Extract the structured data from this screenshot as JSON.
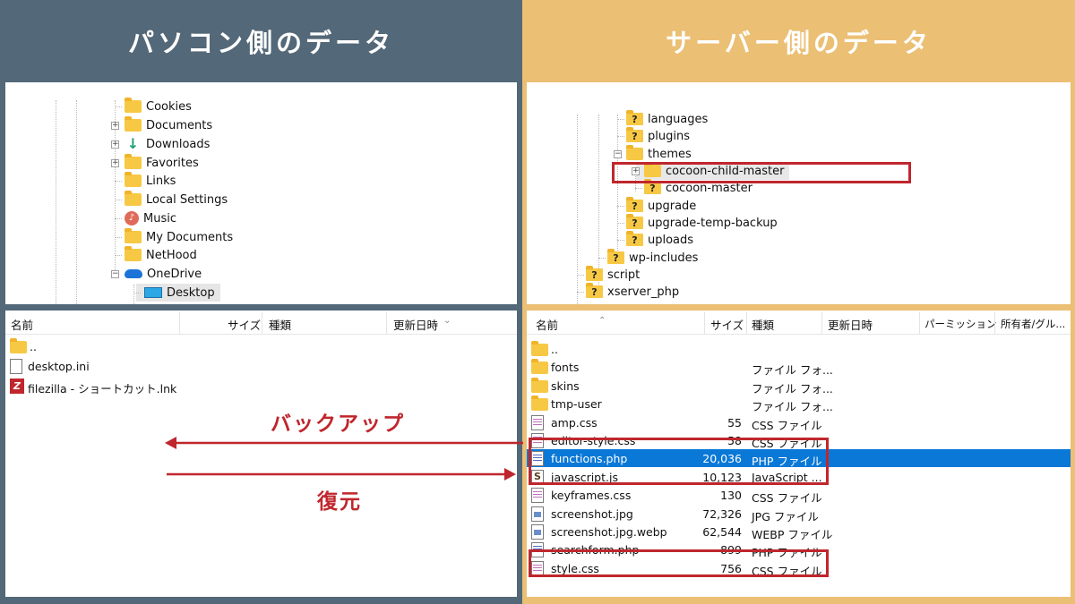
{
  "left": {
    "title": "パソコン側のデータ",
    "tree": [
      {
        "label": "Cookies",
        "icon": "folder-icon",
        "expander": false
      },
      {
        "label": "Documents",
        "icon": "folder-icon",
        "expander": true
      },
      {
        "label": "Downloads",
        "icon": "download-icon",
        "expander": true
      },
      {
        "label": "Favorites",
        "icon": "folder-icon",
        "expander": true
      },
      {
        "label": "Links",
        "icon": "folder-icon",
        "expander": false
      },
      {
        "label": "Local Settings",
        "icon": "folder-icon",
        "expander": false
      },
      {
        "label": "Music",
        "icon": "music-icon",
        "expander": false
      },
      {
        "label": "My Documents",
        "icon": "folder-icon",
        "expander": false
      },
      {
        "label": "NetHood",
        "icon": "folder-icon",
        "expander": false
      },
      {
        "label": "OneDrive",
        "icon": "cloud-icon",
        "expander": true,
        "expanded": true
      },
      {
        "label": "Desktop",
        "icon": "desktop-icon",
        "expander": false,
        "selected": true
      }
    ],
    "headers": {
      "name": "名前",
      "size": "サイズ",
      "type": "種類",
      "modified": "更新日時"
    },
    "files": [
      {
        "name": "..",
        "icon": "folder-icon"
      },
      {
        "name": "desktop.ini",
        "icon": "ini-file-icon"
      },
      {
        "name": "filezilla - ショートカット.lnk",
        "icon": "filezilla-icon"
      }
    ]
  },
  "right": {
    "title": "サーバー側のデータ",
    "tree": [
      {
        "label": "languages",
        "icon": "unknown-folder-icon"
      },
      {
        "label": "plugins",
        "icon": "unknown-folder-icon"
      },
      {
        "label": "themes",
        "icon": "folder-icon",
        "expander": true,
        "expanded": true
      },
      {
        "label": "cocoon-child-master",
        "icon": "folder-icon",
        "expander": true,
        "highlighted": true
      },
      {
        "label": "cocoon-master",
        "icon": "unknown-folder-icon"
      },
      {
        "label": "upgrade",
        "icon": "unknown-folder-icon"
      },
      {
        "label": "upgrade-temp-backup",
        "icon": "unknown-folder-icon"
      },
      {
        "label": "uploads",
        "icon": "unknown-folder-icon"
      },
      {
        "label": "wp-includes",
        "icon": "unknown-folder-icon"
      },
      {
        "label": "script",
        "icon": "unknown-folder-icon"
      },
      {
        "label": "xserver_php",
        "icon": "unknown-folder-icon"
      }
    ],
    "headers": {
      "name": "名前",
      "size": "サイズ",
      "type": "種類",
      "modified": "更新日時",
      "permission": "パーミッション",
      "owner": "所有者/グル..."
    },
    "files": [
      {
        "name": "..",
        "size": "",
        "type": "",
        "icon": "folder-icon"
      },
      {
        "name": "fonts",
        "size": "",
        "type": "ファイル フォ...",
        "icon": "folder-icon"
      },
      {
        "name": "skins",
        "size": "",
        "type": "ファイル フォ...",
        "icon": "folder-icon"
      },
      {
        "name": "tmp-user",
        "size": "",
        "type": "ファイル フォ...",
        "icon": "folder-icon"
      },
      {
        "name": "amp.css",
        "size": "55",
        "type": "CSS ファイル",
        "icon": "css-file-icon"
      },
      {
        "name": "editor-style.css",
        "size": "58",
        "type": "CSS ファイル",
        "icon": "css-file-icon"
      },
      {
        "name": "functions.php",
        "size": "20,036",
        "type": "PHP ファイル",
        "icon": "php-file-icon",
        "selected": true
      },
      {
        "name": "javascript.js",
        "size": "10,123",
        "type": "JavaScript ...",
        "icon": "js-file-icon"
      },
      {
        "name": "keyframes.css",
        "size": "130",
        "type": "CSS ファイル",
        "icon": "css-file-icon"
      },
      {
        "name": "screenshot.jpg",
        "size": "72,326",
        "type": "JPG ファイル",
        "icon": "image-file-icon"
      },
      {
        "name": "screenshot.jpg.webp",
        "size": "62,544",
        "type": "WEBP ファイル",
        "icon": "image-file-icon"
      },
      {
        "name": "searchform.php",
        "size": "899",
        "type": "PHP ファイル",
        "icon": "php-file-icon"
      },
      {
        "name": "style.css",
        "size": "756",
        "type": "CSS ファイル",
        "icon": "css-file-icon"
      }
    ]
  },
  "annotations": {
    "backup": "バックアップ",
    "restore": "復元"
  },
  "colors": {
    "left_bg": "#536878",
    "right_bg": "#ebbf74",
    "accent_red": "#c0262d",
    "selection": "#0a78d7"
  }
}
